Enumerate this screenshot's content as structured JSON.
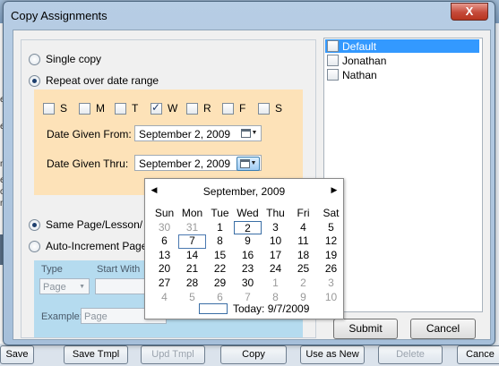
{
  "dialog": {
    "title": "Copy Assignments",
    "close_glyph": "X"
  },
  "copy_mode": {
    "single_copy": "Single copy",
    "repeat_range": "Repeat over date range"
  },
  "weekdays": [
    {
      "label": "S",
      "checked": false
    },
    {
      "label": "M",
      "checked": false
    },
    {
      "label": "T",
      "checked": false
    },
    {
      "label": "W",
      "checked": true
    },
    {
      "label": "R",
      "checked": false
    },
    {
      "label": "F",
      "checked": false
    },
    {
      "label": "S",
      "checked": false
    }
  ],
  "dates": {
    "from_label": "Date Given From:",
    "from_value": "September  2, 2009",
    "thru_label": "Date Given Thru:",
    "thru_value": "September  2, 2009"
  },
  "page_mode": {
    "same_page": "Same Page/Lesson/",
    "auto_increment": "Auto-Increment Page."
  },
  "increment": {
    "type_label": "Type",
    "type_value": "Page",
    "start_label": "Start With",
    "example_label": "Example:",
    "example_placeholder": "Page"
  },
  "users": [
    {
      "name": "Default",
      "checked": false,
      "selected": true
    },
    {
      "name": "Jonathan",
      "checked": false,
      "selected": false
    },
    {
      "name": "Nathan",
      "checked": false,
      "selected": false
    }
  ],
  "actions": {
    "submit": "Submit",
    "cancel": "Cancel"
  },
  "calendar": {
    "month_title": "September, 2009",
    "prev_glyph": "◀",
    "next_glyph": "▶",
    "day_headers": [
      "Sun",
      "Mon",
      "Tue",
      "Wed",
      "Thu",
      "Fri",
      "Sat"
    ],
    "weeks": [
      [
        "30",
        "31",
        "1",
        "2",
        "3",
        "4",
        "5"
      ],
      [
        "6",
        "7",
        "8",
        "9",
        "10",
        "11",
        "12"
      ],
      [
        "13",
        "14",
        "15",
        "16",
        "17",
        "18",
        "19"
      ],
      [
        "20",
        "21",
        "22",
        "23",
        "24",
        "25",
        "26"
      ],
      [
        "27",
        "28",
        "29",
        "30",
        "1",
        "2",
        "3"
      ],
      [
        "4",
        "5",
        "6",
        "7",
        "8",
        "9",
        "10"
      ]
    ],
    "today_label": "Today: 9/7/2009"
  },
  "background": {
    "buttons": [
      "Save",
      "Save Tmpl",
      "Upd Tmpl",
      "Copy",
      "Use as New",
      "Delete",
      "Cance"
    ],
    "fragments": [
      "e:",
      "esn",
      "ns:",
      "e b",
      "ote",
      "n w"
    ]
  }
}
